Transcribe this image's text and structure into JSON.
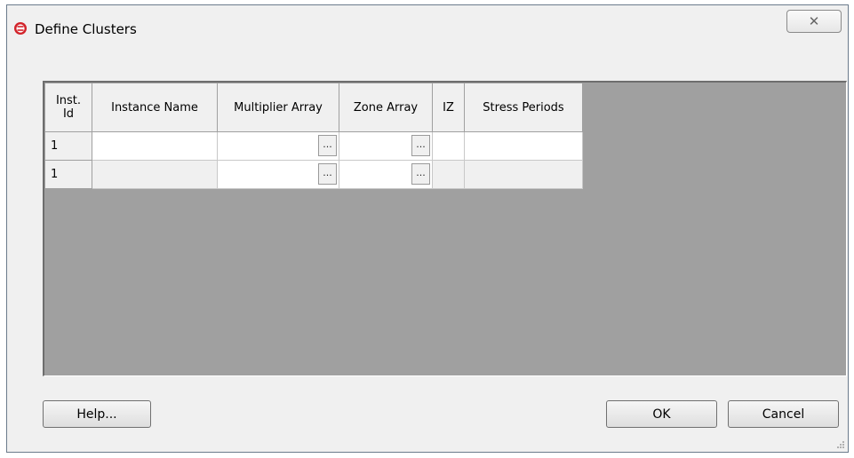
{
  "window": {
    "title": "Define Clusters",
    "close_glyph": "✕"
  },
  "grid": {
    "columns": [
      "Inst.\nId",
      "Instance Name",
      "Multiplier Array",
      "Zone Array",
      "IZ",
      "Stress Periods"
    ],
    "rows": [
      {
        "inst_id": "1",
        "instance_name": "",
        "multiplier_array": "",
        "zone_array": "",
        "iz": "",
        "stress_periods": ""
      },
      {
        "inst_id": "1",
        "instance_name": "",
        "multiplier_array": "",
        "zone_array": "",
        "iz": "",
        "stress_periods": ""
      }
    ],
    "ellipsis_label": "..."
  },
  "buttons": {
    "help": "Help...",
    "ok": "OK",
    "cancel": "Cancel"
  },
  "colors": {
    "grid_background": "#a0a0a0",
    "dialog_background": "#f0f0f0",
    "icon_red": "#d2232a"
  }
}
